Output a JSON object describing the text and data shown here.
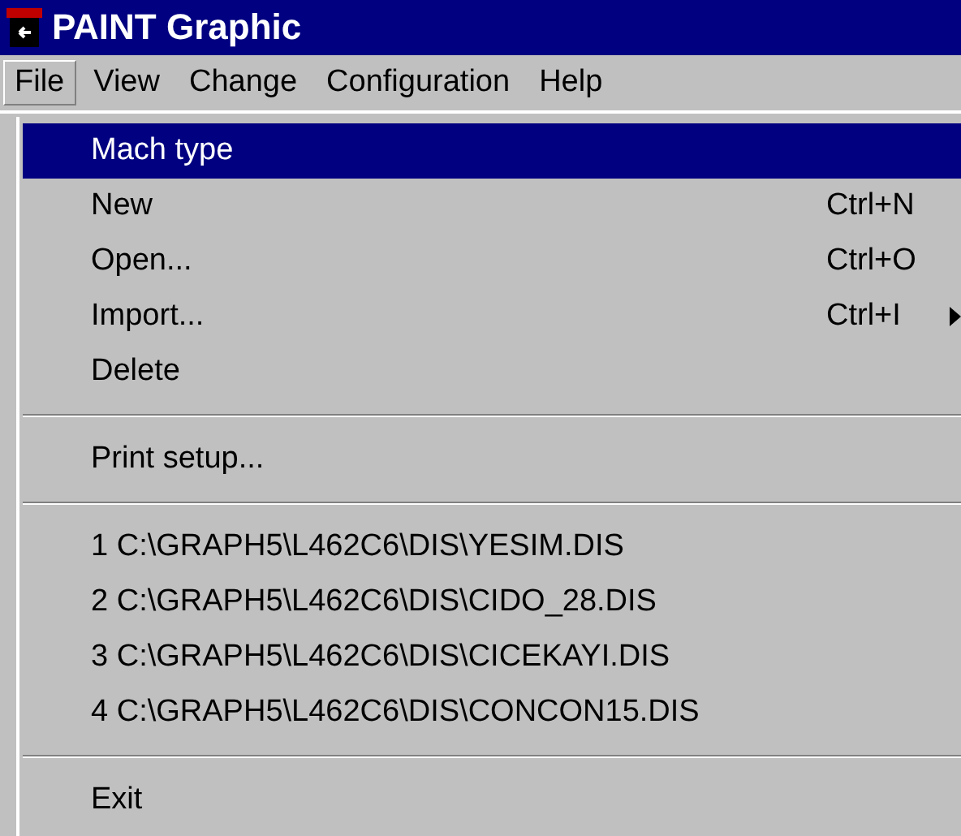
{
  "window": {
    "title": "PAINT Graphic"
  },
  "menu_bar": [
    {
      "label": "File",
      "selected": true
    },
    {
      "label": "View",
      "selected": false
    },
    {
      "label": "Change",
      "selected": false
    },
    {
      "label": "Configuration",
      "selected": false
    },
    {
      "label": "Help",
      "selected": false
    }
  ],
  "menu": [
    {
      "kind": "item",
      "label": "Mach type",
      "selected": true
    },
    {
      "kind": "item",
      "label": "New",
      "shortcut": "Ctrl+N",
      "selected": false
    },
    {
      "kind": "item",
      "label": "Open...",
      "shortcut": "Ctrl+O",
      "selected": false
    },
    {
      "kind": "item",
      "label": "Import...",
      "shortcut": "Ctrl+I",
      "submenu": true,
      "selected": false
    },
    {
      "kind": "item",
      "label": "Delete",
      "selected": false
    },
    {
      "kind": "separator"
    },
    {
      "kind": "item",
      "label": "Print setup...",
      "selected": false
    },
    {
      "kind": "separator"
    },
    {
      "kind": "item",
      "label": "1 C:\\GRAPH5\\L462C6\\DIS\\YESIM.DIS",
      "selected": false
    },
    {
      "kind": "item",
      "label": "2 C:\\GRAPH5\\L462C6\\DIS\\CIDO_28.DIS",
      "selected": false
    },
    {
      "kind": "item",
      "label": "3 C:\\GRAPH5\\L462C6\\DIS\\CICEKAYI.DIS",
      "selected": false
    },
    {
      "kind": "item",
      "label": "4 C:\\GRAPH5\\L462C6\\DIS\\CONCON15.DIS",
      "selected": false
    },
    {
      "kind": "separator"
    },
    {
      "kind": "item",
      "label": "Exit",
      "selected": false
    }
  ]
}
